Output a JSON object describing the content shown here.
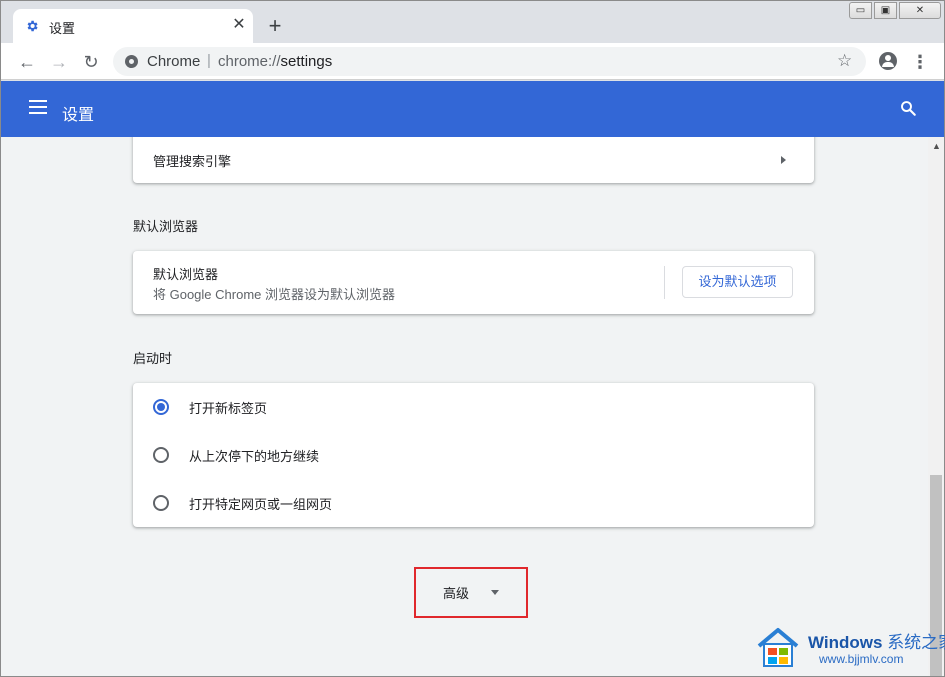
{
  "window": {
    "tab_title": "设置",
    "tab_close": "✕",
    "new_tab": "+",
    "controls": {
      "minimize": "▭",
      "maximize": "▣",
      "close": "✕"
    }
  },
  "toolbar": {
    "back": "←",
    "forward": "→",
    "reload": "↻",
    "omnibox_site": "Chrome",
    "omnibox_separator": "|",
    "omnibox_scheme": "chrome://",
    "omnibox_path": "settings",
    "star": "☆",
    "menu": "⋮"
  },
  "header": {
    "title": "设置",
    "brand_color": "#3367d6"
  },
  "sections": {
    "search_engine": {
      "manage_label": "管理搜索引擎"
    },
    "default_browser": {
      "title": "默认浏览器",
      "row_label": "默认浏览器",
      "row_sublabel": "将 Google Chrome 浏览器设为默认浏览器",
      "button_label": "设为默认选项"
    },
    "startup": {
      "title": "启动时",
      "options": [
        {
          "label": "打开新标签页",
          "selected": true
        },
        {
          "label": "从上次停下的地方继续",
          "selected": false
        },
        {
          "label": "打开特定网页或一组网页",
          "selected": false
        }
      ]
    },
    "advanced": {
      "label": "高级",
      "highlight_color": "#e0272c"
    }
  },
  "watermark": {
    "brand": "Windows",
    "brand_cn": "系统之家",
    "url": "www.bjjmlv.com"
  },
  "icons": [
    "settings-gear-icon",
    "close-icon",
    "plus-icon",
    "back-arrow-icon",
    "forward-arrow-icon",
    "reload-icon",
    "site-info-icon",
    "star-icon",
    "profile-icon",
    "kebab-menu-icon",
    "hamburger-icon",
    "search-icon",
    "arrow-right-icon",
    "caret-down-icon"
  ]
}
